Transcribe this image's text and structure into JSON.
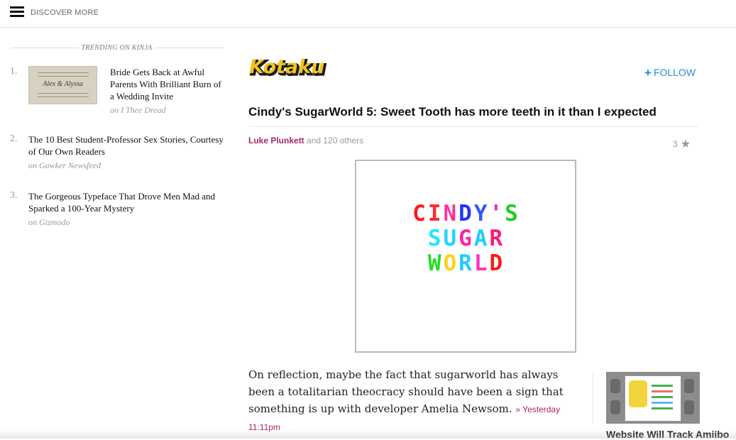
{
  "topbar": {
    "discover_label": "DISCOVER MORE"
  },
  "trending": {
    "heading": "TRENDING ON KINJA",
    "items": [
      {
        "number": "1.",
        "headline": "Bride Gets Back at Awful Parents With Brilliant Burn of a Wedding Invite",
        "source": "on I Thee Dread",
        "thumb_text": "Alex & Alyssa"
      },
      {
        "number": "2.",
        "headline": "The 10 Best Student-Professor Sex Stories, Courtesy of Our Own Readers",
        "source": "on Gawker Newsfeed"
      },
      {
        "number": "3.",
        "headline": "The Gorgeous Typeface That Drove Men Mad and Sparked a 100-Year Mystery",
        "source": "on Gizmodo"
      }
    ]
  },
  "article": {
    "logo_text": "Kotaku",
    "follow_label": "FOLLOW",
    "title": "Cindy's SugarWorld 5: Sweet Tooth has more teeth in it than I expected",
    "author": "Luke Plunkett",
    "others": "and 120 others",
    "stars": "3",
    "image_lines": [
      "CINDY'S",
      "SUGAR",
      "WORLD"
    ],
    "excerpt": "On reflection, maybe the fact that sugarworld has always been a totalitarian theocracy should have been a sign that something is up with developer Amelia Newsom.",
    "timestamp": "» Yesterday 11:11pm"
  },
  "related": {
    "title": "Website Will Track Amiibo"
  },
  "colors": {
    "accent": "#1e8de0",
    "author": "#a8266b",
    "logo_fill": "#f2c31f"
  }
}
